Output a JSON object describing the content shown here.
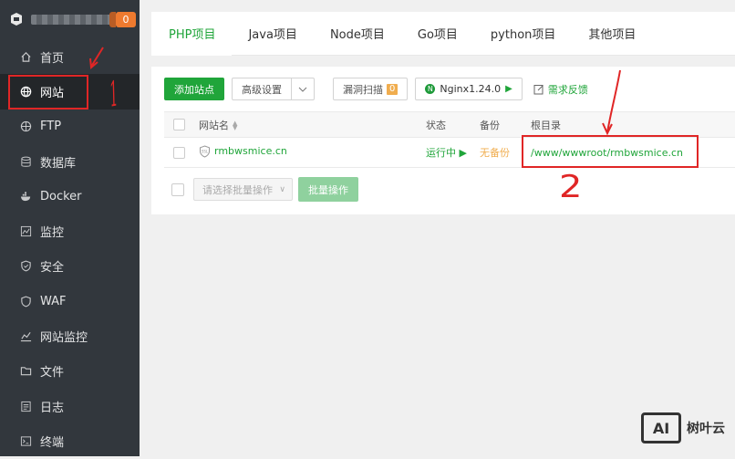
{
  "sidebar": {
    "badge": "0",
    "items": [
      {
        "label": "首页",
        "icon": "home-icon"
      },
      {
        "label": "网站",
        "icon": "globe-icon"
      },
      {
        "label": "FTP",
        "icon": "ftp-globe-icon"
      },
      {
        "label": "数据库",
        "icon": "database-icon"
      },
      {
        "label": "Docker",
        "icon": "docker-icon"
      },
      {
        "label": "监控",
        "icon": "monitor-icon"
      },
      {
        "label": "安全",
        "icon": "shield-icon"
      },
      {
        "label": "WAF",
        "icon": "waf-shield-icon"
      },
      {
        "label": "网站监控",
        "icon": "chart-icon"
      },
      {
        "label": "文件",
        "icon": "folder-icon"
      },
      {
        "label": "日志",
        "icon": "log-icon"
      },
      {
        "label": "终端",
        "icon": "terminal-icon"
      }
    ],
    "active_index": 1
  },
  "tabs": [
    "PHP项目",
    "Java项目",
    "Node项目",
    "Go项目",
    "python项目",
    "其他项目"
  ],
  "active_tab": 0,
  "toolbar": {
    "add_site": "添加站点",
    "advanced": "高级设置",
    "scan": "漏洞扫描",
    "scan_count": "0",
    "nginx": "Nginx1.24.0",
    "feedback": "需求反馈"
  },
  "table": {
    "headers": {
      "name": "网站名",
      "status": "状态",
      "backup": "备份",
      "root": "根目录"
    },
    "rows": [
      {
        "name": "rmbwsmice.cn",
        "status": "运行中",
        "backup": "无备份",
        "root": "/www/wwwroot/rmbwsmice.cn"
      }
    ]
  },
  "batch": {
    "select_placeholder": "请选择批量操作",
    "button": "批量操作"
  },
  "annotation": {
    "number_one": "1",
    "number_two": "2"
  },
  "watermark": {
    "logo": "AI",
    "text": "树叶云"
  },
  "colors": {
    "accent": "#20a53a",
    "warning": "#f0ad4e",
    "annotation": "#e02626",
    "sidebar": "#32373d"
  }
}
